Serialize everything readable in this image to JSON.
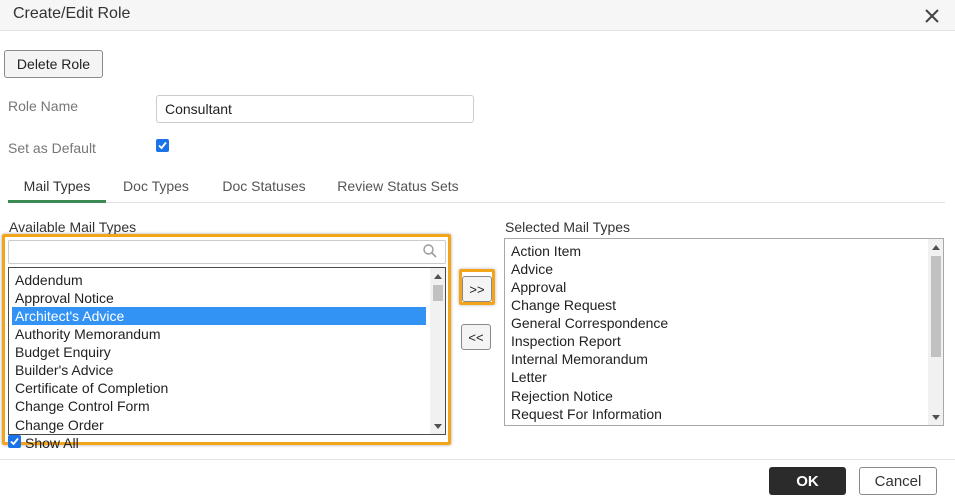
{
  "dialog": {
    "title": "Create/Edit Role",
    "close_icon": "close-icon"
  },
  "toolbar": {
    "delete_label": "Delete Role"
  },
  "form": {
    "role_name_label": "Role Name",
    "role_name_value": "Consultant",
    "set_default_label": "Set as Default",
    "set_default_checked": true
  },
  "tabs": [
    {
      "label": "Mail Types",
      "active": true
    },
    {
      "label": "Doc Types",
      "active": false
    },
    {
      "label": "Doc Statuses",
      "active": false
    },
    {
      "label": "Review Status Sets",
      "active": false
    }
  ],
  "available": {
    "label": "Available Mail Types",
    "search_value": "",
    "search_icon": "search-icon",
    "items": [
      "Addendum",
      "Approval Notice",
      "Architect's Advice",
      "Authority Memorandum",
      "Budget Enquiry",
      "Builder's Advice",
      "Certificate of Completion",
      "Change Control Form",
      "Change Order"
    ],
    "selected_index": 2,
    "show_all_label": "Show All",
    "show_all_checked": true
  },
  "move": {
    "add_label": ">>",
    "remove_label": "<<"
  },
  "selected": {
    "label": "Selected Mail Types",
    "items": [
      "Action Item",
      "Advice",
      "Approval",
      "Change Request",
      "General Correspondence",
      "Inspection Report",
      "Internal Memorandum",
      "Letter",
      "Rejection Notice",
      "Request For Information"
    ]
  },
  "footer": {
    "ok_label": "OK",
    "cancel_label": "Cancel"
  },
  "colors": {
    "accent_highlight": "#f2a51a",
    "selection_blue": "#3393f5",
    "active_tab_underline": "#3d8b54",
    "checkbox_blue": "#1a73e8"
  }
}
